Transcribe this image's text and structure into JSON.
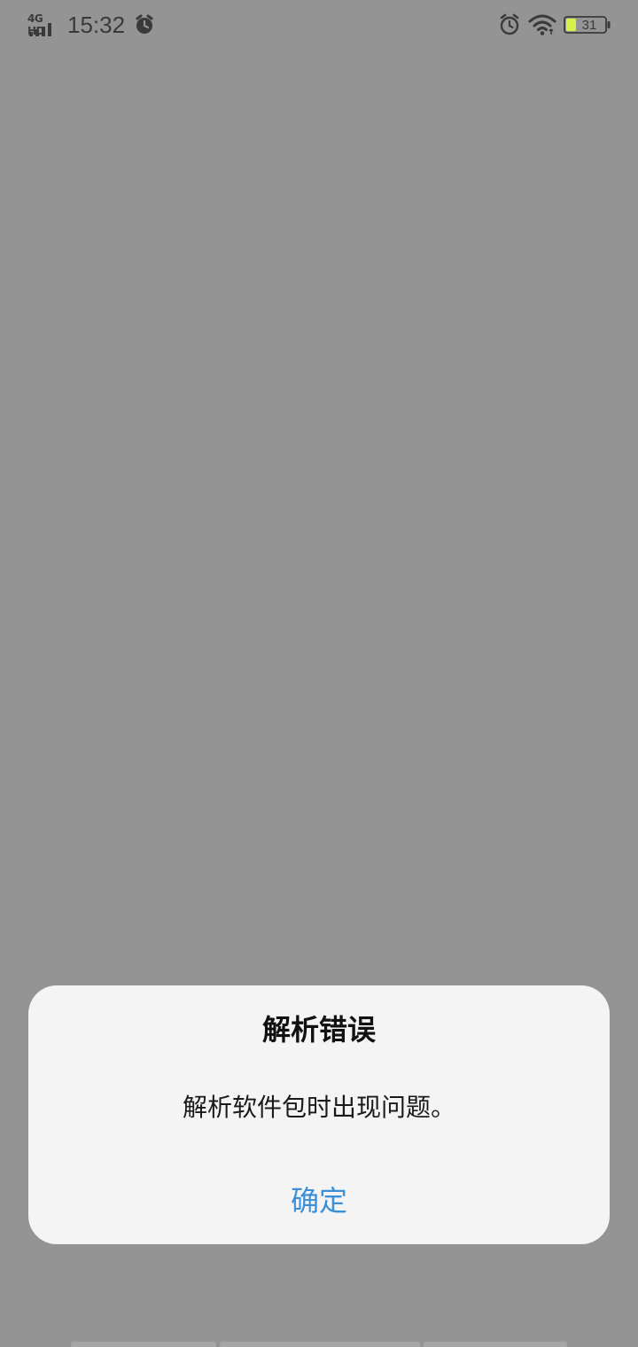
{
  "status_bar": {
    "network": "4G HD",
    "time": "15:32",
    "battery_level": "31",
    "icons": {
      "signal": "signal-bars-icon",
      "alarm_left": "alarm-clock-icon",
      "alarm_right": "alarm-clock-icon",
      "wifi": "wifi-icon",
      "battery": "battery-icon"
    }
  },
  "dialog": {
    "title": "解析错误",
    "message": "解析软件包时出现问题。",
    "confirm_label": "确定"
  },
  "colors": {
    "backdrop": "#949494",
    "dialog_bg": "#f4f4f4",
    "accent": "#3a8fd6",
    "battery_fill": "#d4f24a"
  }
}
